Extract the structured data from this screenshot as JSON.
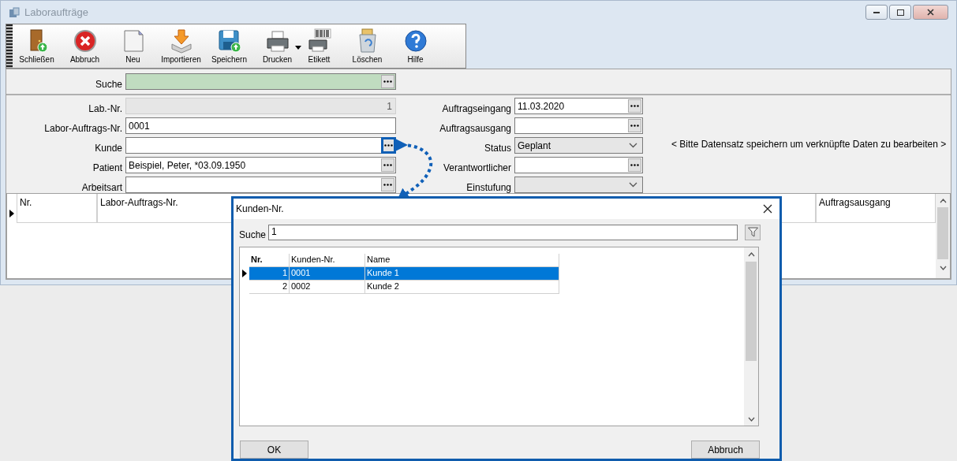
{
  "window": {
    "title": "Laboraufträge"
  },
  "toolbar": [
    {
      "label": "Schließen",
      "has_menu": false
    },
    {
      "label": "Abbruch",
      "has_menu": false
    },
    {
      "label": "Neu",
      "has_menu": false
    },
    {
      "label": "Importieren",
      "has_menu": false
    },
    {
      "label": "Speichern",
      "has_menu": false
    },
    {
      "label": "Drucken",
      "has_menu": true
    },
    {
      "label": "Etikett",
      "has_menu": false
    },
    {
      "label": "Löschen",
      "has_menu": false
    },
    {
      "label": "Hilfe",
      "has_menu": false
    }
  ],
  "search": {
    "label": "Suche"
  },
  "form_left": [
    {
      "label": "Lab.-Nr.",
      "value": "1",
      "kind": "readonly"
    },
    {
      "label": "Labor-Auftrags-Nr.",
      "value": "0001",
      "kind": "text"
    },
    {
      "label": "Kunde",
      "kind": "lookup",
      "highlighted": true
    },
    {
      "label": "Patient",
      "value": "Beispiel, Peter, *03.09.1950",
      "kind": "lookup",
      "highlighted": false
    },
    {
      "label": "Arbeitsart",
      "kind": "lookup",
      "highlighted": false
    }
  ],
  "form_right": [
    {
      "label": "Auftragseingang",
      "value": "11.03.2020",
      "kind": "lookup"
    },
    {
      "label": "Auftragsausgang",
      "kind": "lookup"
    },
    {
      "label": "Status",
      "value": "Geplant",
      "kind": "combo"
    },
    {
      "label": "Verantwortlicher",
      "kind": "lookup"
    },
    {
      "label": "Einstufung",
      "kind": "combo"
    }
  ],
  "notice": "< Bitte Datensatz speichern um verknüpfte Daten zu bearbeiten >",
  "grid": {
    "columns": [
      {
        "label": "Nr."
      },
      {
        "label": "Labor-Auftrags-Nr."
      },
      {
        "label": "Auftragsausgang"
      }
    ]
  },
  "dialog": {
    "title": "Kunden-Nr.",
    "search_label": "Suche",
    "search_value": "1",
    "columns": [
      {
        "label": "Nr."
      },
      {
        "label": "Kunden-Nr."
      },
      {
        "label": "Name"
      }
    ],
    "rows": [
      {
        "cells": [
          "1",
          "0001",
          "Kunde 1"
        ],
        "selected": true
      },
      {
        "cells": [
          "2",
          "0002",
          "Kunde 2"
        ],
        "selected": false
      }
    ],
    "buttons": [
      "OK",
      "Abbruch"
    ]
  }
}
